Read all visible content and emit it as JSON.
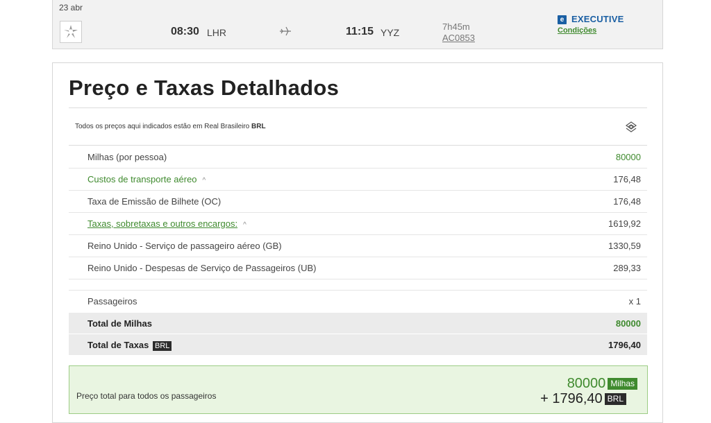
{
  "flight": {
    "date": "23 abr",
    "depart_time": "08:30",
    "depart_airport": "LHR",
    "arrive_time": "11:15",
    "arrive_airport": "YYZ",
    "duration": "7h45m",
    "flight_number": "AC0853",
    "cabin_letter": "e",
    "cabin": "EXECUTIVE",
    "conditions_link": "Condições"
  },
  "price": {
    "title": "Preço e Taxas Detalhados",
    "currency_note_prefix": "Todos os preços aqui indicados estão em Real Brasileiro ",
    "currency_code": "BRL",
    "rows": [
      {
        "label": "Milhas (por pessoa)",
        "value": "80000"
      },
      {
        "label": "Custos de transporte aéreo",
        "value": "176,48"
      },
      {
        "label": "Taxa de Emissão de Bilhete (OC)",
        "value": "176,48"
      },
      {
        "label": "Taxas, sobretaxas e outros encargos:",
        "value": "1619,92"
      },
      {
        "label": "Reino Unido - Serviço de passageiro aéreo (GB)",
        "value": "1330,59"
      },
      {
        "label": "Reino Unido - Despesas de Serviço de Passageiros (UB)",
        "value": "289,33"
      }
    ],
    "passengers_label": "Passageiros",
    "passengers_value": "x 1",
    "total_miles_label": "Total de Milhas",
    "total_miles_value": "80000",
    "total_taxes_label": "Total de Taxas",
    "total_taxes_badge": "BRL",
    "total_taxes_value": "1796,40"
  },
  "summary": {
    "label": "Preço total para todos os passageiros",
    "miles": "80000",
    "miles_tag": "Milhas",
    "brl": "+ 1796,40",
    "brl_tag": "BRL"
  },
  "colors": {
    "accent_green": "#3f8a2e",
    "cabin_blue": "#1a5fa3",
    "summary_bg": "#e9f5e1"
  }
}
